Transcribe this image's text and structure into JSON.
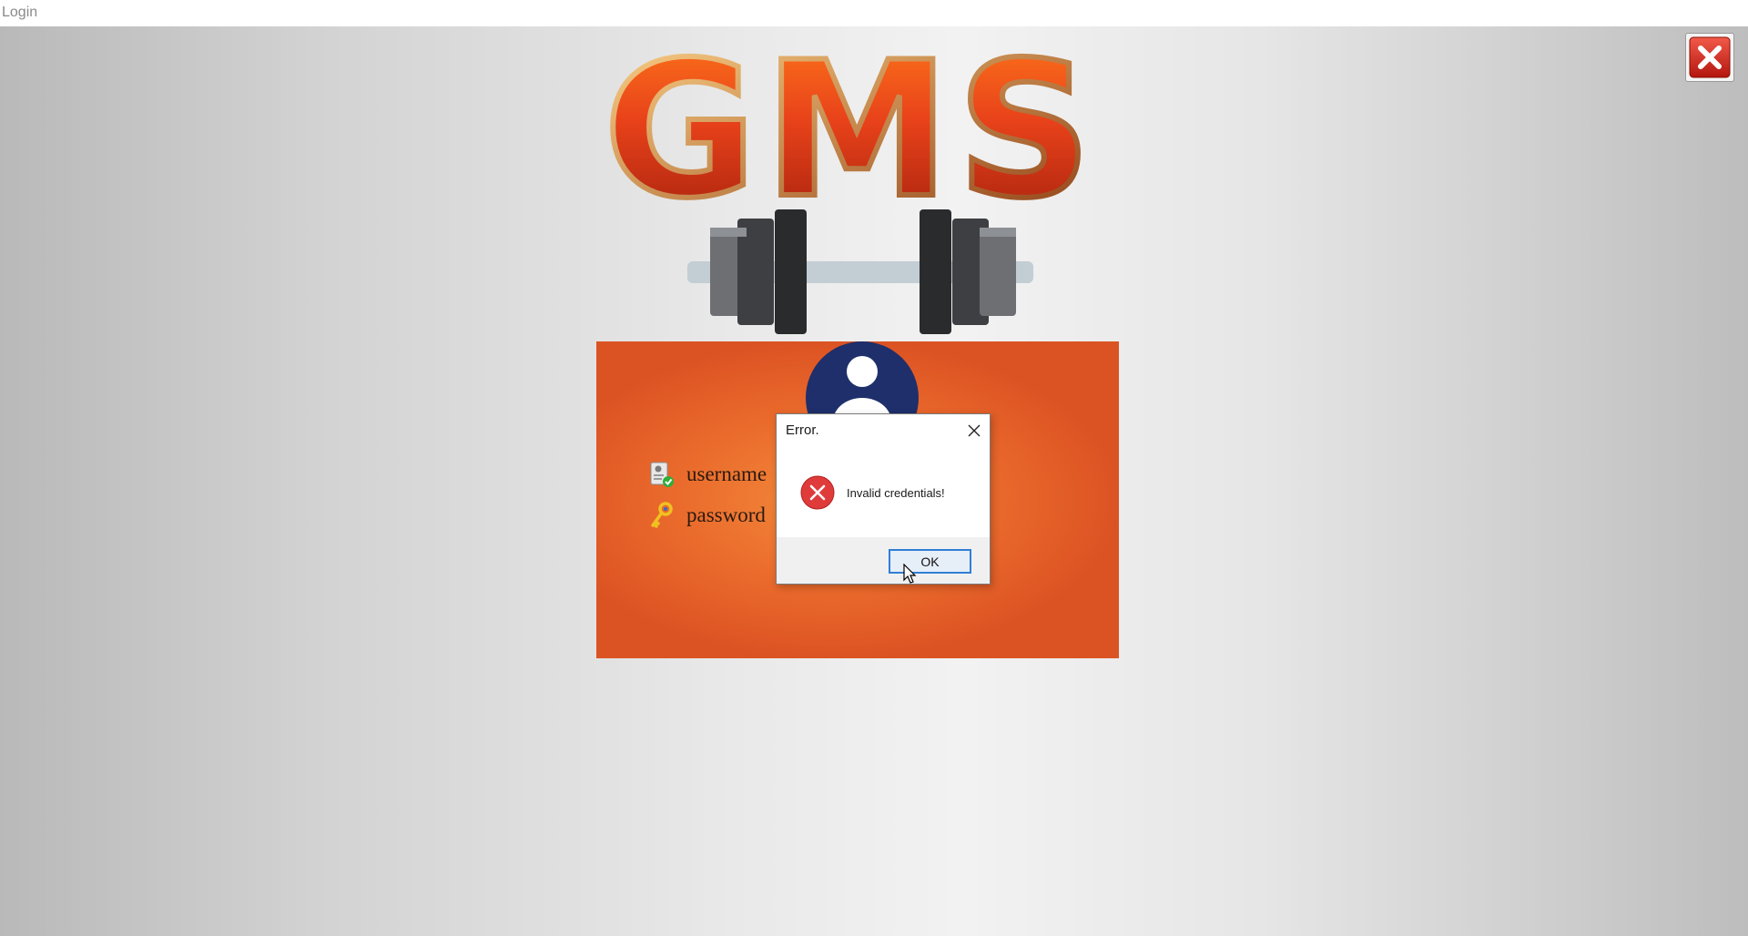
{
  "window": {
    "title": "Login"
  },
  "logo": {
    "text": "GMS"
  },
  "form": {
    "username_label": "username",
    "password_label": "password"
  },
  "dialog": {
    "title": "Error.",
    "message": "Invalid credentials!",
    "ok_label": "OK"
  },
  "colors": {
    "panel": "#e8652b",
    "avatar": "#1e2f6b",
    "error_icon": "#e03b3b",
    "ok_border": "#2f7fd6"
  },
  "icons": {
    "app_close": "close-x-icon",
    "user": "user-avatar-icon",
    "username": "user-id-icon",
    "password": "key-icon",
    "dialog_close": "close-icon",
    "error": "error-icon",
    "pointer": "mouse-cursor-icon"
  }
}
